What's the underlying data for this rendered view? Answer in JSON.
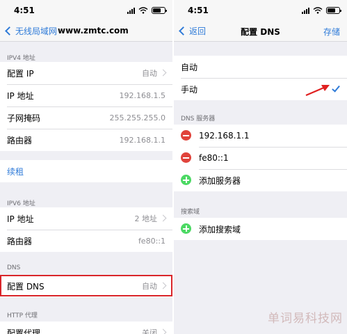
{
  "left": {
    "status": {
      "time": "4:51"
    },
    "nav": {
      "back_label": "无线局域网",
      "title": "www.zmtc.com"
    },
    "ipv4": {
      "header": "IPV4 地址",
      "rows": [
        {
          "label": "配置 IP",
          "value": "自动"
        },
        {
          "label": "IP 地址",
          "value": "192.168.1.5"
        },
        {
          "label": "子网掩码",
          "value": "255.255.255.0"
        },
        {
          "label": "路由器",
          "value": "192.168.1.1"
        }
      ]
    },
    "renew": {
      "label": "续租"
    },
    "ipv6": {
      "header": "IPV6 地址",
      "rows": [
        {
          "label": "IP 地址",
          "value": "2 地址"
        },
        {
          "label": "路由器",
          "value": "fe80::1"
        }
      ]
    },
    "dns": {
      "header": "DNS",
      "label": "配置 DNS",
      "value": "自动"
    },
    "http_proxy": {
      "header": "HTTP 代理",
      "label": "配置代理",
      "value": "关闭"
    }
  },
  "right": {
    "status": {
      "time": "4:51"
    },
    "nav": {
      "back_label": "返回",
      "title": "配置 DNS",
      "save_label": "存储"
    },
    "mode": {
      "auto_label": "自动",
      "manual_label": "手动"
    },
    "dns_servers": {
      "header": "DNS 服务器",
      "servers": [
        "192.168.1.1",
        "fe80::1"
      ],
      "add_label": "添加服务器"
    },
    "search_domains": {
      "header": "搜索域",
      "add_label": "添加搜索域"
    }
  },
  "watermark": "单词易科技网",
  "colors": {
    "accent": "#2f7bd8",
    "delete": "#e0433b",
    "add": "#4cd964",
    "highlight": "#d9252a",
    "arrow": "#e02020"
  }
}
